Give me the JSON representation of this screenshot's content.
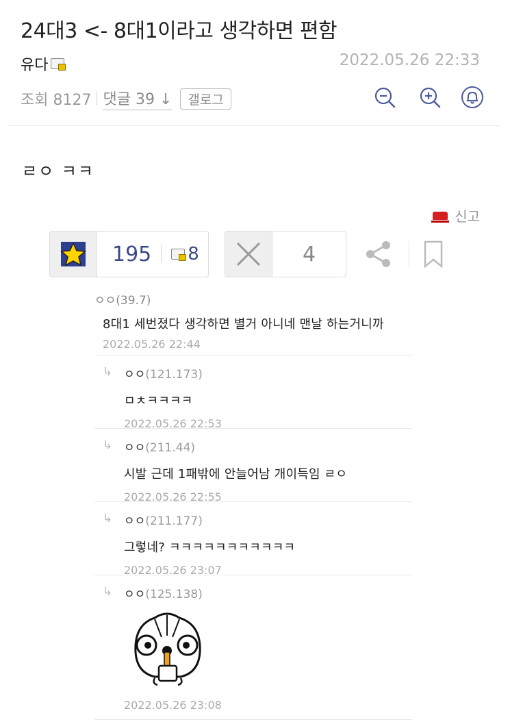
{
  "post": {
    "title": "24대3 <- 8대1이라고 생각하면 편함",
    "author": "유다",
    "date": "2022.05.26 22:33",
    "views_label": "조회 8127",
    "comments_label": "댓글 39",
    "gallog_label": "갤로그",
    "body": "ㄹㅇ ㅋㅋ"
  },
  "actions": {
    "report_label": "신고",
    "recommend_count": "195",
    "fixed_recommend_count": "8",
    "not_recommend_count": "4"
  },
  "comments": [
    {
      "nick": "ㅇㅇ(39.7)",
      "text": "8대1 세번졌다 생각하면 별거 아니네 맨날 하는거니까",
      "date": "2022.05.26 22:44"
    },
    {
      "nick": "ㅇㅇ",
      "ip": "(121.173)",
      "text": "ㅁㅊㅋㅋㅋㅋ",
      "date": "2022.05.26 22:53"
    },
    {
      "nick": "ㅇㅇ",
      "ip": "(211.44)",
      "text": "시발 근데 1패밖에 안늘어남 개이득임 ㄹㅇ",
      "date": "2022.05.26 22:55"
    },
    {
      "nick": "ㅇㅇ",
      "ip": "(211.177)",
      "text": "그렇네? ㅋㅋㅋㅋㅋㅋㅋㅋㅋㅋㅋ",
      "date": "2022.05.26 23:07"
    },
    {
      "nick": "ㅇㅇ",
      "ip": "(125.138)",
      "date": "2022.05.26 23:08"
    }
  ],
  "colors": {
    "count_blue": "#3b4a86",
    "report_red": "#d32020"
  },
  "icons": [
    "zoom-out-icon",
    "zoom-in-icon",
    "bell-icon",
    "star-icon",
    "x-icon",
    "share-icon",
    "bookmark-icon",
    "reply-arrow-icon"
  ]
}
